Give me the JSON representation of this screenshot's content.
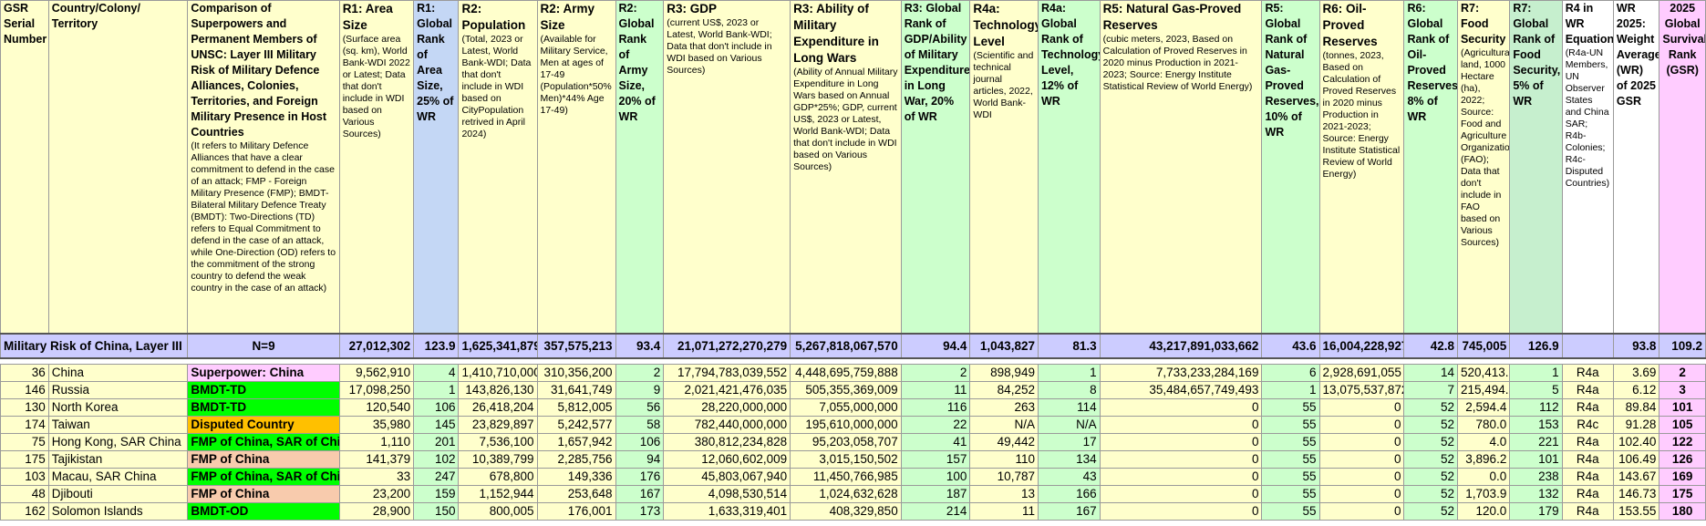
{
  "headers": {
    "serial": {
      "title": "GSR Serial Number"
    },
    "country": {
      "title": "Country/Colony/ Territory"
    },
    "comparison": {
      "title": "Comparison of Superpowers and Permanent Members of UNSC: Layer III Military Risk of Military Defence Alliances, Colonies, Territories, and Foreign Military Presence in Host Countries",
      "note": "(It refers to Military Defence Alliances that have a clear commitment to defend in the case of an attack; FMP - Foreign Military Presence (FMP); BMDT-Bilateral Military Defence Treaty (BMDT): Two-Directions (TD) refers to Equal Commitment to defend in the case of an attack, while One-Direction (OD) refers to the commitment of the strong country to defend the weak country in the case of an attack)"
    },
    "r1_area": {
      "title": "R1: Area Size",
      "note": "(Surface area (sq. km), World Bank-WDI 2022 or Latest; Data that don't include in WDI based on Various Sources)"
    },
    "r1_rank": {
      "title": "R1: Global Rank of Area Size, 25% of WR"
    },
    "r2_pop": {
      "title": "R2: Population",
      "note": "(Total, 2023 or Latest, World Bank-WDI; Data that don't include in WDI based on CityPopulation retrived in April 2024)"
    },
    "r2_army": {
      "title": "R2: Army Size",
      "note": "(Available for Military Service, Men at ages of 17-49 (Population*50% Men)*44% Age 17-49)"
    },
    "r2_rank": {
      "title": "R2: Global Rank of Army Size, 20% of WR"
    },
    "r3_gdp": {
      "title": "R3: GDP",
      "note": "(current US$, 2023 or Latest, World Bank-WDI; Data that don't include in WDI based on Various Sources)"
    },
    "r3_ability": {
      "title": "R3: Ability of Military Expenditure in Long Wars",
      "note": "(Ability of Annual Military Expenditure in Long Wars based on Annual GDP*25%; GDP, current US$, 2023 or Latest, World Bank-WDI; Data that don't include in WDI based on Various Sources)"
    },
    "r3_rank": {
      "title": "R3: Global Rank of GDP/Ability of Military Expenditure in Long War, 20% of WR"
    },
    "r4a_tech": {
      "title": "R4a: Technology Level",
      "note": "(Scientific and technical journal articles, 2022, World Bank-WDI"
    },
    "r4a_rank": {
      "title": "R4a: Global Rank of Technology Level, 12% of WR"
    },
    "r5_gas": {
      "title": "R5: Natural Gas-Proved Reserves",
      "note": "(cubic meters, 2023, Based on Calculation of Proved Reserves in 2020 minus Production in 2021-2023; Source: Energy Institute Statistical Review of World Energy)"
    },
    "r5_rank": {
      "title": "R5: Global Rank of Natural Gas-Proved Reserves, 10% of WR"
    },
    "r6_oil": {
      "title": "R6: Oil-Proved Reserves",
      "note": "(tonnes, 2023, Based on Calculation of Proved Reserves in 2020 minus Production in 2021-2023; Source: Energy Institute Statistical Review of World Energy)"
    },
    "r6_rank": {
      "title": "R6: Global Rank of Oil-Proved Reserves, 8% of WR"
    },
    "r7_food": {
      "title": "R7: Food Security",
      "note": "(Agricultural land, 1000 Hectare (ha), 2022; Source: Food and Agriculture Organization (FAO); Data that don't include in FAO based on Various Sources)"
    },
    "r7_rank": {
      "title": "R7: Global Rank of Food Security, 5% of WR"
    },
    "r4_wr": {
      "title": "R4 in WR Equation",
      "note": "(R4a-UN Members, UN Observer States and China SAR; R4b-Colonies; R4c-Disputed Countries)"
    },
    "wr": {
      "title": "WR 2025: Weight Average (WR) of 2025 GSR"
    },
    "gsr": {
      "title": "2025 Global Survival Rank (GSR)"
    }
  },
  "summary": {
    "label": "Military Risk of China, Layer III",
    "n": "N=9",
    "area": "27,012,302",
    "area_rank": "123.9",
    "pop": "1,625,341,879",
    "army": "357,575,213",
    "army_rank": "93.4",
    "gdp": "21,071,272,270,279",
    "ability": "5,267,818,067,570",
    "gdp_rank": "94.4",
    "tech": "1,043,827",
    "tech_rank": "81.3",
    "gas": "43,217,891,033,662",
    "gas_rank": "43.6",
    "oil": "16,004,228,927",
    "oil_rank": "42.8",
    "food": "745,005",
    "food_rank": "126.9",
    "r4": "",
    "wr": "93.8",
    "gsr": "109.2"
  },
  "category_colors": {
    "Superpower: China": "#ffccff",
    "BMDT-TD": "#00ff00",
    "Disputed Country": "#ffc000",
    "FMP of China, SAR of China": "#00ff00",
    "FMP of China": "#f8cbad",
    "BMDT-OD": "#00ff00"
  },
  "rows": [
    {
      "serial": "36",
      "country": "China",
      "category": "Superpower: China",
      "area": "9,562,910",
      "area_rank": "4",
      "pop": "1,410,710,000",
      "army": "310,356,200",
      "army_rank": "2",
      "gdp": "17,794,783,039,552",
      "ability": "4,448,695,759,888",
      "gdp_rank": "2",
      "tech": "898,949",
      "tech_rank": "1",
      "gas": "7,733,233,284,169",
      "gas_rank": "6",
      "oil": "2,928,691,055",
      "oil_rank": "14",
      "food": "520,413.0",
      "food_rank": "1",
      "r4": "R4a",
      "wr": "3.69",
      "gsr": "2"
    },
    {
      "serial": "146",
      "country": "Russia",
      "category": "BMDT-TD",
      "area": "17,098,250",
      "area_rank": "1",
      "pop": "143,826,130",
      "army": "31,641,749",
      "army_rank": "9",
      "gdp": "2,021,421,476,035",
      "ability": "505,355,369,009",
      "gdp_rank": "11",
      "tech": "84,252",
      "tech_rank": "8",
      "gas": "35,484,657,749,493",
      "gas_rank": "1",
      "oil": "13,075,537,872",
      "oil_rank": "7",
      "food": "215,494.0",
      "food_rank": "5",
      "r4": "R4a",
      "wr": "6.12",
      "gsr": "3"
    },
    {
      "serial": "130",
      "country": "North Korea",
      "category": "BMDT-TD",
      "area": "120,540",
      "area_rank": "106",
      "pop": "26,418,204",
      "army": "5,812,005",
      "army_rank": "56",
      "gdp": "28,220,000,000",
      "ability": "7,055,000,000",
      "gdp_rank": "116",
      "tech": "263",
      "tech_rank": "114",
      "gas": "0",
      "gas_rank": "55",
      "oil": "0",
      "oil_rank": "52",
      "food": "2,594.4",
      "food_rank": "112",
      "r4": "R4a",
      "wr": "89.84",
      "gsr": "101"
    },
    {
      "serial": "174",
      "country": "Taiwan",
      "category": "Disputed Country",
      "area": "35,980",
      "area_rank": "145",
      "pop": "23,829,897",
      "army": "5,242,577",
      "army_rank": "58",
      "gdp": "782,440,000,000",
      "ability": "195,610,000,000",
      "gdp_rank": "22",
      "tech": "N/A",
      "tech_rank": "N/A",
      "gas": "0",
      "gas_rank": "55",
      "oil": "0",
      "oil_rank": "52",
      "food": "780.0",
      "food_rank": "153",
      "r4": "R4c",
      "wr": "91.28",
      "gsr": "105"
    },
    {
      "serial": "75",
      "country": "Hong Kong, SAR China",
      "category": "FMP of China, SAR of China",
      "area": "1,110",
      "area_rank": "201",
      "pop": "7,536,100",
      "army": "1,657,942",
      "army_rank": "106",
      "gdp": "380,812,234,828",
      "ability": "95,203,058,707",
      "gdp_rank": "41",
      "tech": "49,442",
      "tech_rank": "17",
      "gas": "0",
      "gas_rank": "55",
      "oil": "0",
      "oil_rank": "52",
      "food": "4.0",
      "food_rank": "221",
      "r4": "R4a",
      "wr": "102.40",
      "gsr": "122"
    },
    {
      "serial": "175",
      "country": "Tajikistan",
      "category": "FMP of China",
      "area": "141,379",
      "area_rank": "102",
      "pop": "10,389,799",
      "army": "2,285,756",
      "army_rank": "94",
      "gdp": "12,060,602,009",
      "ability": "3,015,150,502",
      "gdp_rank": "157",
      "tech": "110",
      "tech_rank": "134",
      "gas": "0",
      "gas_rank": "55",
      "oil": "0",
      "oil_rank": "52",
      "food": "3,896.2",
      "food_rank": "101",
      "r4": "R4a",
      "wr": "106.49",
      "gsr": "126"
    },
    {
      "serial": "103",
      "country": "Macau, SAR China",
      "category": "FMP of China, SAR of China",
      "area": "33",
      "area_rank": "247",
      "pop": "678,800",
      "army": "149,336",
      "army_rank": "176",
      "gdp": "45,803,067,940",
      "ability": "11,450,766,985",
      "gdp_rank": "100",
      "tech": "10,787",
      "tech_rank": "43",
      "gas": "0",
      "gas_rank": "55",
      "oil": "0",
      "oil_rank": "52",
      "food": "0.0",
      "food_rank": "238",
      "r4": "R4a",
      "wr": "143.67",
      "gsr": "169"
    },
    {
      "serial": "48",
      "country": "Djibouti",
      "category": "FMP of China",
      "area": "23,200",
      "area_rank": "159",
      "pop": "1,152,944",
      "army": "253,648",
      "army_rank": "167",
      "gdp": "4,098,530,514",
      "ability": "1,024,632,628",
      "gdp_rank": "187",
      "tech": "13",
      "tech_rank": "166",
      "gas": "0",
      "gas_rank": "55",
      "oil": "0",
      "oil_rank": "52",
      "food": "1,703.9",
      "food_rank": "132",
      "r4": "R4a",
      "wr": "146.73",
      "gsr": "175"
    },
    {
      "serial": "162",
      "country": "Solomon Islands",
      "category": "BMDT-OD",
      "area": "28,900",
      "area_rank": "150",
      "pop": "800,005",
      "army": "176,001",
      "army_rank": "173",
      "gdp": "1,633,319,401",
      "ability": "408,329,850",
      "gdp_rank": "214",
      "tech": "11",
      "tech_rank": "167",
      "gas": "0",
      "gas_rank": "55",
      "oil": "0",
      "oil_rank": "52",
      "food": "120.0",
      "food_rank": "179",
      "r4": "R4a",
      "wr": "153.55",
      "gsr": "180"
    }
  ]
}
